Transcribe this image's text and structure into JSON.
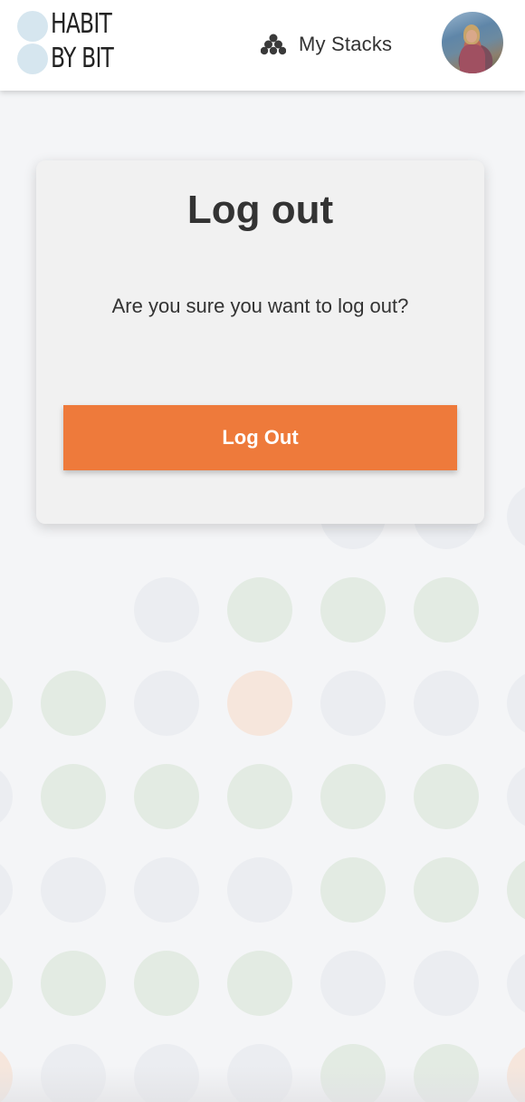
{
  "header": {
    "logo_line1": "HABIT",
    "logo_line2": "BY BIT",
    "nav_stacks_label": "My Stacks",
    "stacks_icon": "stacks-icon",
    "avatar_icon": "user-avatar"
  },
  "dialog": {
    "title": "Log out",
    "message": "Are you sure you want to log out?",
    "button_label": "Log Out"
  },
  "colors": {
    "accent": "#ee7a3b",
    "logo_dot": "#d6e6ef",
    "dot_gray": "#ebedf1",
    "dot_green": "#e3ebe3",
    "dot_orange": "#f6e6dc"
  },
  "background_dots": {
    "rows": [
      [
        "hidden",
        "hidden",
        "hidden",
        "gray",
        "gray",
        "gray"
      ],
      [
        "hidden",
        "gray",
        "green",
        "green",
        "green",
        "hidden"
      ],
      [
        "green",
        "gray",
        "orange",
        "gray",
        "gray",
        "gray"
      ],
      [
        "green",
        "green",
        "green",
        "green",
        "green",
        "gray"
      ],
      [
        "gray",
        "gray",
        "gray",
        "green",
        "green",
        "green"
      ],
      [
        "green",
        "green",
        "green",
        "gray",
        "gray",
        "gray"
      ],
      [
        "gray",
        "gray",
        "gray",
        "green",
        "green",
        "orange"
      ]
    ]
  }
}
